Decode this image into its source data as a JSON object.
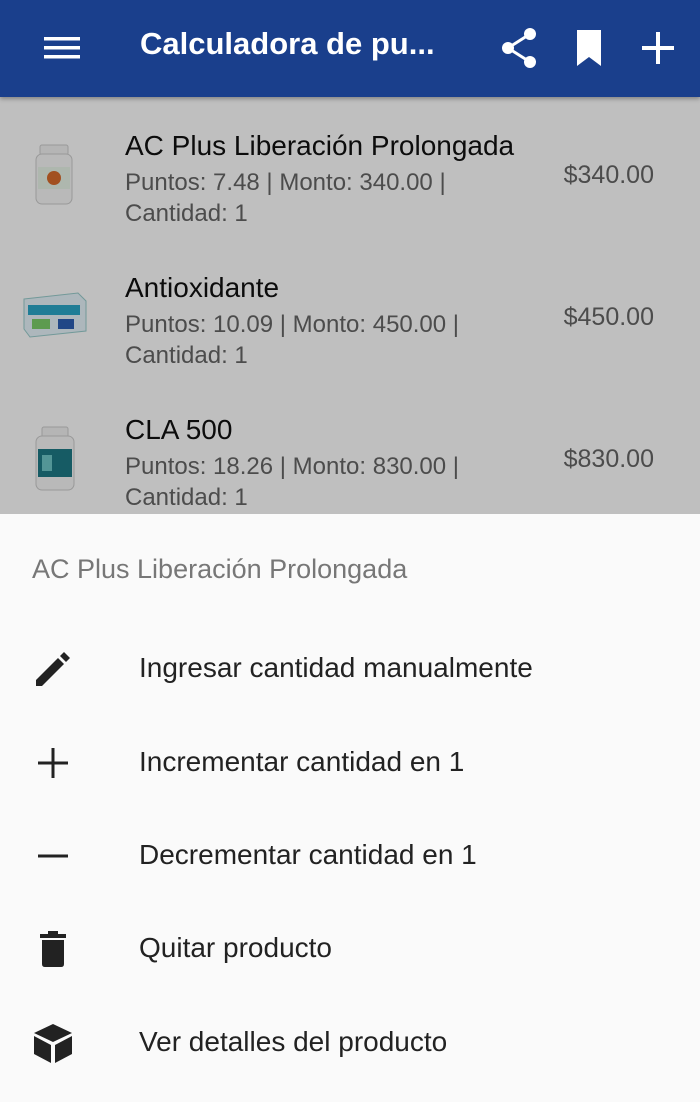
{
  "appbar": {
    "title": "Calculadora de pu...",
    "icons": [
      "menu-icon",
      "share-icon",
      "bookmark-icon",
      "add-icon"
    ],
    "color": "#1a3f8c"
  },
  "products": [
    {
      "name": "AC Plus Liberación Prolongada",
      "detail": "Puntos: 7.48 | Monto: 340.00 | Cantidad: 1",
      "price": "$340.00"
    },
    {
      "name": "Antioxidante",
      "detail": "Puntos: 10.09 | Monto: 450.00 | Cantidad: 1",
      "price": "$450.00"
    },
    {
      "name": "CLA 500",
      "detail": "Puntos: 18.26 | Monto: 830.00 | Cantidad: 1",
      "price": "$830.00"
    }
  ],
  "sheet": {
    "title": "AC Plus Liberación Prolongada",
    "items": [
      {
        "label": "Ingresar cantidad manualmente",
        "icon": "pencil-icon"
      },
      {
        "label": "Incrementar cantidad en 1",
        "icon": "plus-icon"
      },
      {
        "label": "Decrementar cantidad en 1",
        "icon": "minus-icon"
      },
      {
        "label": "Quitar producto",
        "icon": "trash-icon"
      },
      {
        "label": "Ver detalles del producto",
        "icon": "box-icon"
      }
    ]
  }
}
